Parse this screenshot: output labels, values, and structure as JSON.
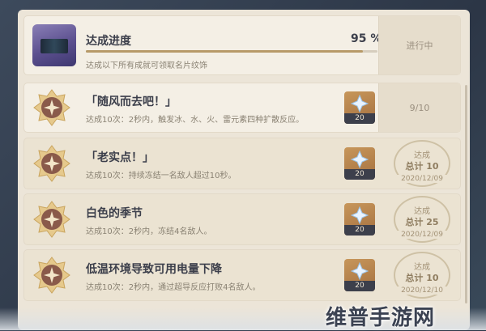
{
  "header": {
    "title": "达成进度",
    "subtitle": "达成以下所有成就可领取名片纹饰",
    "percent_label": "95 %",
    "progress": 0.95,
    "status": "进行中"
  },
  "achievements": [
    {
      "title": "「随风而去吧！」",
      "desc": "达成10次：2秒内，触发冰、水、火、雷元素四种扩散反应。",
      "reward": "20",
      "progress_text": "9/10",
      "completed": false
    },
    {
      "title": "「老实点！」",
      "desc": "达成10次：持续冻结一名敌人超过10秒。",
      "reward": "20",
      "stamp_top": "达成",
      "stamp_total": "总计 10",
      "stamp_date": "2020/12/09",
      "completed": true
    },
    {
      "title": "白色的季节",
      "desc": "达成10次：2秒内，冻结4名敌人。",
      "reward": "20",
      "stamp_top": "达成",
      "stamp_total": "总计 25",
      "stamp_date": "2020/12/09",
      "completed": true
    },
    {
      "title": "低温环境导致可用电量下降",
      "desc": "达成10次：2秒内，通过超导反应打败4名敌人。",
      "reward": "20",
      "stamp_top": "达成",
      "stamp_total": "总计 10",
      "stamp_date": "2020/12/10",
      "completed": true
    }
  ],
  "watermark": "维普手游网",
  "colors": {
    "panel": "#ece5d8",
    "accent": "#b79a68",
    "text": "#3c3f4b",
    "reward_bg": "#c7965a"
  }
}
